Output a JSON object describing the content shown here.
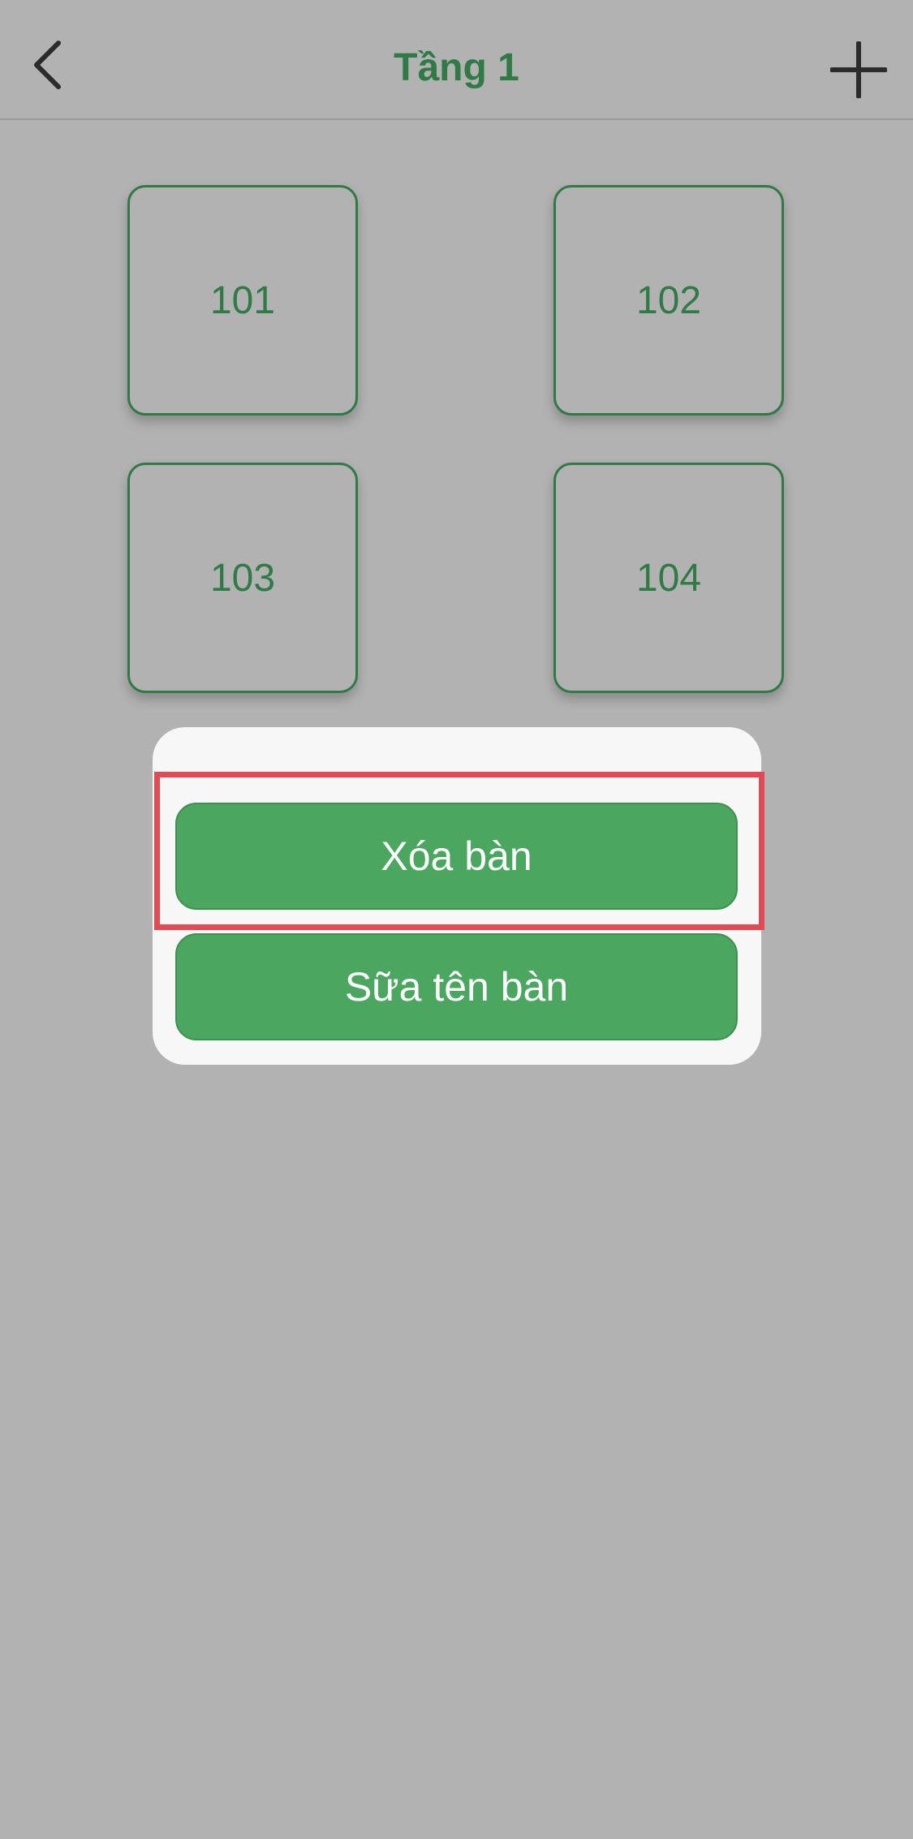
{
  "header": {
    "title": "Tầng 1",
    "back_icon": "chevron-left-icon",
    "add_icon": "plus-icon"
  },
  "tables": [
    {
      "label": "101"
    },
    {
      "label": "102"
    },
    {
      "label": "103"
    },
    {
      "label": "104"
    }
  ],
  "popup": {
    "delete_label": "Xóa bàn",
    "rename_label": "Sữa tên bàn"
  },
  "colors": {
    "accent_green": "#2f7a45",
    "button_green": "#4ba760",
    "highlight_red": "#e44a53",
    "overlay_gray": "#b2b2b2"
  }
}
